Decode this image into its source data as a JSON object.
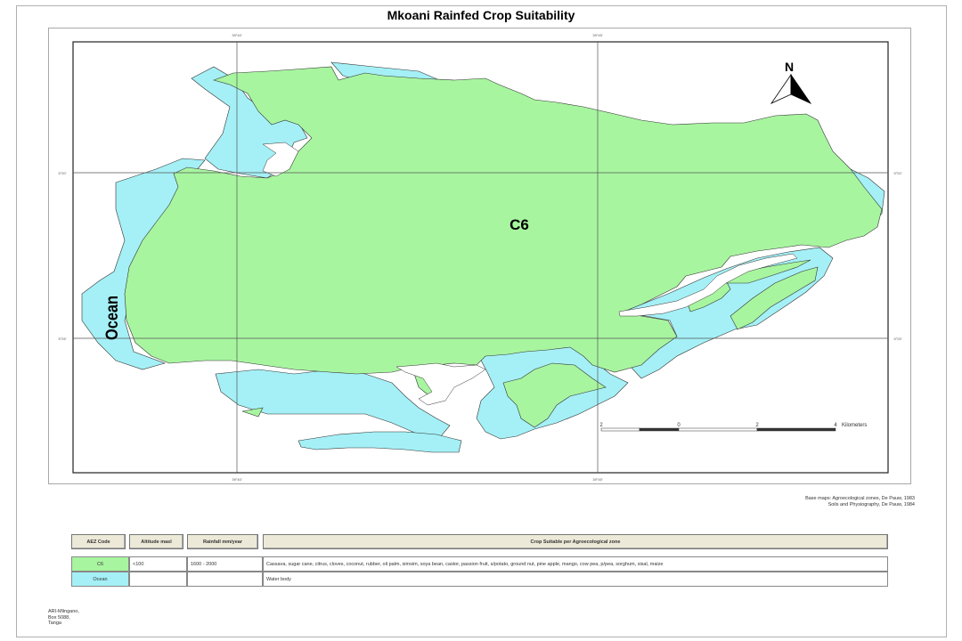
{
  "title": "Mkoani Rainfed Crop Suitability",
  "colors": {
    "land": "#a8f5a0",
    "ocean": "#a4f0f6",
    "grid": "#444444",
    "header_bg": "#ece9d8"
  },
  "map": {
    "zone_label": "C6",
    "ocean_label": "Ocean",
    "north_label": "N",
    "north_icon": "north-arrow-icon",
    "tick_labels": {
      "top": [
        "39°40'",
        "39°45'"
      ],
      "bottom": [
        "39°40'",
        "39°45'"
      ],
      "left": [
        "5°20'",
        "5°25'"
      ],
      "right": [
        "5°20'",
        "5°25'"
      ]
    },
    "scale_bar": {
      "ticks": [
        "2",
        "0",
        "2",
        "4"
      ],
      "unit": "Kilometers"
    }
  },
  "credits": [
    "Base maps: Agroecological zones, De Pauw, 1983",
    "Soils and Physiography, De Pauw, 1984"
  ],
  "legend": {
    "headers": [
      "AEZ Code",
      "Altitude masl",
      "Rainfall mm/year",
      "Crop Suitable per Agroecological zone"
    ],
    "rows": [
      {
        "code": "C6",
        "color": "#a8f5a0",
        "altitude": "<100",
        "rainfall": "1600 - 2000",
        "crops": "Cassava, sugar cane, citrus, cloves, coconut, rubber, oil palm, simsim, soya bean, castor, passion fruit, s/potato, ground nut, pine apple, mango, cow pea, p/pea, sorghum, sisal, maize"
      },
      {
        "code": "Ocean",
        "color": "#a4f0f6",
        "altitude": "",
        "rainfall": "",
        "crops": "Water body"
      }
    ]
  },
  "address": [
    "ARI-Mlingano,",
    "Box 5088,",
    "Tanga"
  ]
}
